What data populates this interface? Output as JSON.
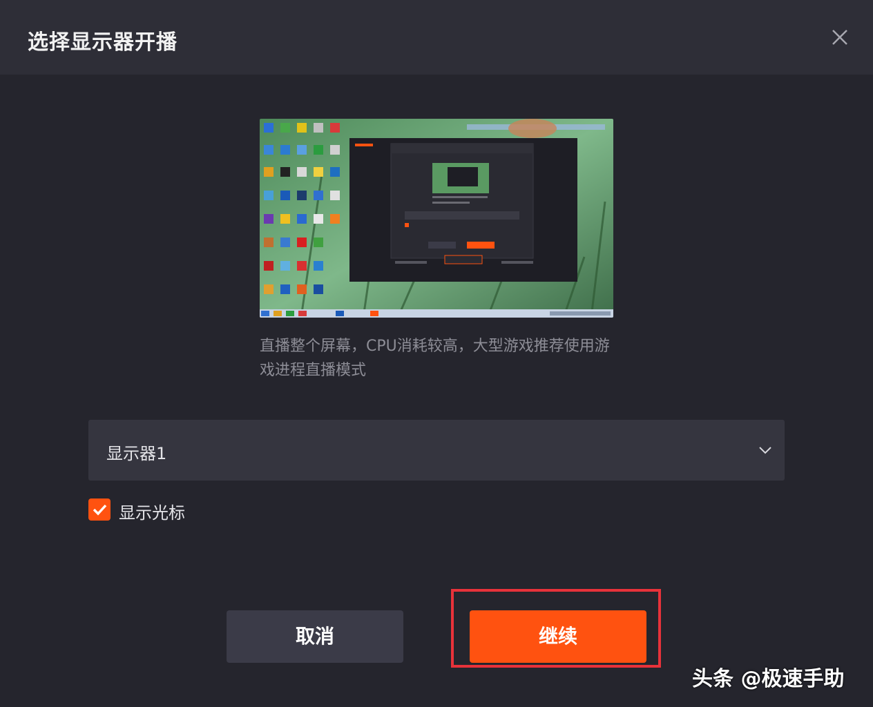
{
  "dialog": {
    "title": "选择显示器开播",
    "description": "直播整个屏幕，CPU消耗较高，大型游戏推荐使用游戏进程直播模式",
    "display_select": {
      "value": "显示器1"
    },
    "show_cursor": {
      "label": "显示光标",
      "checked": true
    },
    "buttons": {
      "cancel": "取消",
      "continue": "继续"
    }
  },
  "watermark": "头条 @极速手助",
  "colors": {
    "accent": "#ff5210",
    "highlight_border": "#e8323a",
    "background": "#25252d",
    "titlebar": "#2e2e37"
  },
  "icons": {
    "close": "close-icon",
    "dropdown": "chevron-down-icon",
    "checkbox": "check-icon"
  }
}
